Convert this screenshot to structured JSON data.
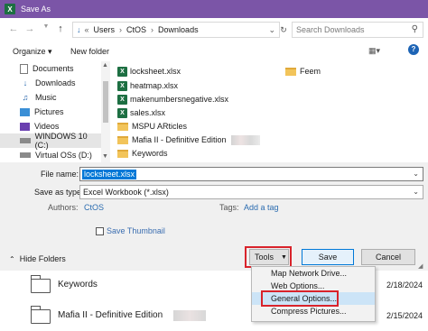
{
  "window": {
    "title": "Save As",
    "app_icon": "excel-icon"
  },
  "address": {
    "segments": [
      "Users",
      "CtOS",
      "Downloads"
    ],
    "overflow": "«",
    "search_placeholder": "Search Downloads"
  },
  "toolbar": {
    "organize": "Organize ▾",
    "new_folder": "New folder",
    "help": "?"
  },
  "nav": {
    "items": [
      {
        "label": "Documents",
        "icon": "documents-icon"
      },
      {
        "label": "Downloads",
        "icon": "downloads-icon"
      },
      {
        "label": "Music",
        "icon": "music-icon"
      },
      {
        "label": "Pictures",
        "icon": "pictures-icon"
      },
      {
        "label": "Videos",
        "icon": "videos-icon"
      },
      {
        "label": "WINDOWS 10 (C:)",
        "icon": "drive-icon",
        "selected": true
      },
      {
        "label": "Virtual OSs (D:)",
        "icon": "drive-icon"
      }
    ]
  },
  "files": {
    "lockheet": "locksheet.xlsx",
    "heatmap": "heatmap.xlsx",
    "makeneg": "makenumbersnegative.xlsx",
    "sales": "sales.xlsx",
    "mspu": "MSPU ARticles",
    "mafia": "Mafia II - Definitive Edition",
    "keywords": "Keywords",
    "feem": "Feem"
  },
  "form": {
    "file_name_label": "File name:",
    "file_name_value": "locksheet.xlsx",
    "save_type_label": "Save as type:",
    "save_type_value": "Excel Workbook (*.xlsx)",
    "authors_label": "Authors:",
    "authors_value": "CtOS",
    "tags_label": "Tags:",
    "tags_value": "Add a tag",
    "thumbnail_label": "Save Thumbnail",
    "hide_folders": "Hide Folders",
    "tools": "Tools",
    "save": "Save",
    "cancel": "Cancel"
  },
  "tools_menu": {
    "items": [
      "Map Network Drive...",
      "Web Options...",
      "General Options...",
      "Compress Pictures..."
    ],
    "highlighted": "General Options..."
  },
  "background_list": {
    "rows": [
      {
        "name": "Keywords",
        "date": "2/18/2024"
      },
      {
        "name": "Mafia II - Definitive Edition",
        "date": "2/15/2024"
      }
    ]
  },
  "colors": {
    "titlebar": "#7b55a7",
    "highlight_box": "#d9232b",
    "accent": "#0078d7"
  }
}
